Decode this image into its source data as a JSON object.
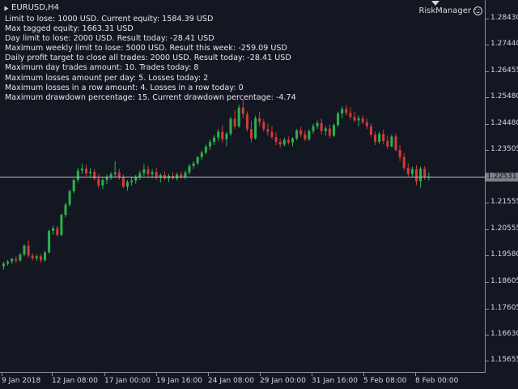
{
  "chart": {
    "symbol": "EURUSD,H4",
    "indicator_name": "RiskManager",
    "current_price": "1.22531",
    "colors": {
      "background": "#131722",
      "bull": "#2bb24c",
      "bear": "#d23b3b",
      "text": "#e6e6e6",
      "axis": "#8a8f99",
      "current_line": "#b9bcc3"
    }
  },
  "info_lines": [
    "Limit to lose: 1000 USD. Current equity: 1584.39 USD",
    "Max tagged equity: 1663.31 USD",
    "Day limit to lose: 2000 USD. Result today: -28.41 USD",
    "Maximum weekly limit to lose: 5000 USD. Result this week: -259.09 USD",
    "Daily profit target to close all trades: 2000 USD. Result today: -28.41 USD",
    "Maximum day trades amount: 10. Trades today: 8",
    "Maximum losses amount per day: 5. Losses today: 2",
    "Maximum losses in a row amount: 4. Losses in a row today: 0",
    "Maximum drawdown percentage: 15. Current drawdown percentage: -4.74"
  ],
  "price_axis": {
    "labels": [
      "1.28430",
      "1.27440",
      "1.26455",
      "1.25480",
      "1.24480",
      "1.23505",
      "1.22531",
      "1.21555",
      "1.20555",
      "1.19580",
      "1.18605",
      "1.17605",
      "1.16630",
      "1.15655"
    ],
    "min": 1.1545,
    "max": 1.2893
  },
  "time_axis": {
    "labels": [
      "9 Jan 2018",
      "12 Jan 08:00",
      "17 Jan 00:00",
      "19 Jan 16:00",
      "24 Jan 08:00",
      "29 Jan 00:00",
      "31 Jan 16:00",
      "5 Feb 08:00",
      "8 Feb 00:00"
    ]
  },
  "chart_data": {
    "type": "candlestick",
    "series": [
      {
        "o": 1.1918,
        "h": 1.1935,
        "l": 1.1905,
        "c": 1.1928
      },
      {
        "o": 1.1928,
        "h": 1.1942,
        "l": 1.192,
        "c": 1.1936
      },
      {
        "o": 1.1936,
        "h": 1.195,
        "l": 1.1926,
        "c": 1.1945
      },
      {
        "o": 1.1945,
        "h": 1.1955,
        "l": 1.193,
        "c": 1.194
      },
      {
        "o": 1.194,
        "h": 1.1968,
        "l": 1.1935,
        "c": 1.1962
      },
      {
        "o": 1.1962,
        "h": 1.2,
        "l": 1.1955,
        "c": 1.1995
      },
      {
        "o": 1.1995,
        "h": 1.2015,
        "l": 1.195,
        "c": 1.1958
      },
      {
        "o": 1.1958,
        "h": 1.1966,
        "l": 1.194,
        "c": 1.1948
      },
      {
        "o": 1.1948,
        "h": 1.1962,
        "l": 1.1938,
        "c": 1.1955
      },
      {
        "o": 1.1955,
        "h": 1.1965,
        "l": 1.193,
        "c": 1.194
      },
      {
        "o": 1.194,
        "h": 1.1975,
        "l": 1.1936,
        "c": 1.197
      },
      {
        "o": 1.197,
        "h": 1.2055,
        "l": 1.1965,
        "c": 1.205
      },
      {
        "o": 1.205,
        "h": 1.207,
        "l": 1.2035,
        "c": 1.206
      },
      {
        "o": 1.206,
        "h": 1.207,
        "l": 1.2028,
        "c": 1.2035
      },
      {
        "o": 1.2035,
        "h": 1.2115,
        "l": 1.203,
        "c": 1.211
      },
      {
        "o": 1.211,
        "h": 1.2155,
        "l": 1.21,
        "c": 1.2148
      },
      {
        "o": 1.2148,
        "h": 1.2205,
        "l": 1.214,
        "c": 1.2198
      },
      {
        "o": 1.2198,
        "h": 1.2245,
        "l": 1.219,
        "c": 1.224
      },
      {
        "o": 1.224,
        "h": 1.2285,
        "l": 1.223,
        "c": 1.2275
      },
      {
        "o": 1.2275,
        "h": 1.23,
        "l": 1.2262,
        "c": 1.2282
      },
      {
        "o": 1.2282,
        "h": 1.2296,
        "l": 1.2255,
        "c": 1.2265
      },
      {
        "o": 1.2265,
        "h": 1.2285,
        "l": 1.2248,
        "c": 1.227
      },
      {
        "o": 1.227,
        "h": 1.228,
        "l": 1.2238,
        "c": 1.2245
      },
      {
        "o": 1.2245,
        "h": 1.2262,
        "l": 1.221,
        "c": 1.222
      },
      {
        "o": 1.222,
        "h": 1.2248,
        "l": 1.2205,
        "c": 1.224
      },
      {
        "o": 1.224,
        "h": 1.226,
        "l": 1.2225,
        "c": 1.225
      },
      {
        "o": 1.225,
        "h": 1.227,
        "l": 1.224,
        "c": 1.2262
      },
      {
        "o": 1.2262,
        "h": 1.231,
        "l": 1.225,
        "c": 1.2268
      },
      {
        "o": 1.2268,
        "h": 1.2282,
        "l": 1.224,
        "c": 1.225
      },
      {
        "o": 1.225,
        "h": 1.226,
        "l": 1.221,
        "c": 1.2215
      },
      {
        "o": 1.2215,
        "h": 1.224,
        "l": 1.22,
        "c": 1.2232
      },
      {
        "o": 1.2232,
        "h": 1.225,
        "l": 1.2218,
        "c": 1.2238
      },
      {
        "o": 1.2238,
        "h": 1.2258,
        "l": 1.2226,
        "c": 1.2252
      },
      {
        "o": 1.2252,
        "h": 1.2275,
        "l": 1.224,
        "c": 1.2265
      },
      {
        "o": 1.2265,
        "h": 1.2298,
        "l": 1.2255,
        "c": 1.228
      },
      {
        "o": 1.228,
        "h": 1.2292,
        "l": 1.2252,
        "c": 1.2262
      },
      {
        "o": 1.2262,
        "h": 1.228,
        "l": 1.2245,
        "c": 1.227
      },
      {
        "o": 1.227,
        "h": 1.2285,
        "l": 1.224,
        "c": 1.2248
      },
      {
        "o": 1.2248,
        "h": 1.2265,
        "l": 1.223,
        "c": 1.2258
      },
      {
        "o": 1.2258,
        "h": 1.2272,
        "l": 1.224,
        "c": 1.2245
      },
      {
        "o": 1.2245,
        "h": 1.2262,
        "l": 1.2232,
        "c": 1.2255
      },
      {
        "o": 1.2255,
        "h": 1.227,
        "l": 1.224,
        "c": 1.2246
      },
      {
        "o": 1.2246,
        "h": 1.2268,
        "l": 1.2238,
        "c": 1.226
      },
      {
        "o": 1.226,
        "h": 1.2272,
        "l": 1.2244,
        "c": 1.225
      },
      {
        "o": 1.225,
        "h": 1.2275,
        "l": 1.2242,
        "c": 1.2268
      },
      {
        "o": 1.2268,
        "h": 1.23,
        "l": 1.226,
        "c": 1.2292
      },
      {
        "o": 1.2292,
        "h": 1.231,
        "l": 1.228,
        "c": 1.2302
      },
      {
        "o": 1.2302,
        "h": 1.233,
        "l": 1.2295,
        "c": 1.2325
      },
      {
        "o": 1.2325,
        "h": 1.235,
        "l": 1.2315,
        "c": 1.2342
      },
      {
        "o": 1.2342,
        "h": 1.2372,
        "l": 1.2335,
        "c": 1.2365
      },
      {
        "o": 1.2365,
        "h": 1.239,
        "l": 1.2352,
        "c": 1.2382
      },
      {
        "o": 1.2382,
        "h": 1.2408,
        "l": 1.237,
        "c": 1.2398
      },
      {
        "o": 1.2398,
        "h": 1.243,
        "l": 1.2385,
        "c": 1.242
      },
      {
        "o": 1.242,
        "h": 1.2445,
        "l": 1.238,
        "c": 1.2392
      },
      {
        "o": 1.2392,
        "h": 1.242,
        "l": 1.2365,
        "c": 1.2412
      },
      {
        "o": 1.2412,
        "h": 1.2475,
        "l": 1.2405,
        "c": 1.2468
      },
      {
        "o": 1.2468,
        "h": 1.25,
        "l": 1.243,
        "c": 1.244
      },
      {
        "o": 1.244,
        "h": 1.252,
        "l": 1.2435,
        "c": 1.251
      },
      {
        "o": 1.251,
        "h": 1.254,
        "l": 1.247,
        "c": 1.2485
      },
      {
        "o": 1.2485,
        "h": 1.2495,
        "l": 1.242,
        "c": 1.243
      },
      {
        "o": 1.243,
        "h": 1.246,
        "l": 1.238,
        "c": 1.2395
      },
      {
        "o": 1.2395,
        "h": 1.248,
        "l": 1.239,
        "c": 1.247
      },
      {
        "o": 1.247,
        "h": 1.2495,
        "l": 1.244,
        "c": 1.2455
      },
      {
        "o": 1.2455,
        "h": 1.2468,
        "l": 1.242,
        "c": 1.243
      },
      {
        "o": 1.243,
        "h": 1.245,
        "l": 1.2405,
        "c": 1.242
      },
      {
        "o": 1.242,
        "h": 1.244,
        "l": 1.2392,
        "c": 1.24
      },
      {
        "o": 1.24,
        "h": 1.2418,
        "l": 1.237,
        "c": 1.2382
      },
      {
        "o": 1.2382,
        "h": 1.2395,
        "l": 1.236,
        "c": 1.2372
      },
      {
        "o": 1.2372,
        "h": 1.2398,
        "l": 1.2365,
        "c": 1.239
      },
      {
        "o": 1.239,
        "h": 1.2402,
        "l": 1.2372,
        "c": 1.238
      },
      {
        "o": 1.238,
        "h": 1.24,
        "l": 1.2365,
        "c": 1.2395
      },
      {
        "o": 1.2395,
        "h": 1.243,
        "l": 1.2388,
        "c": 1.2425
      },
      {
        "o": 1.2425,
        "h": 1.244,
        "l": 1.24,
        "c": 1.241
      },
      {
        "o": 1.241,
        "h": 1.2425,
        "l": 1.2385,
        "c": 1.2392
      },
      {
        "o": 1.2392,
        "h": 1.243,
        "l": 1.2385,
        "c": 1.2422
      },
      {
        "o": 1.2422,
        "h": 1.245,
        "l": 1.2412,
        "c": 1.244
      },
      {
        "o": 1.244,
        "h": 1.2462,
        "l": 1.243,
        "c": 1.2452
      },
      {
        "o": 1.2452,
        "h": 1.247,
        "l": 1.241,
        "c": 1.2422
      },
      {
        "o": 1.2422,
        "h": 1.244,
        "l": 1.2405,
        "c": 1.2432
      },
      {
        "o": 1.2432,
        "h": 1.2448,
        "l": 1.2395,
        "c": 1.2405
      },
      {
        "o": 1.2405,
        "h": 1.245,
        "l": 1.24,
        "c": 1.2445
      },
      {
        "o": 1.2445,
        "h": 1.2495,
        "l": 1.2438,
        "c": 1.2488
      },
      {
        "o": 1.2488,
        "h": 1.2515,
        "l": 1.247,
        "c": 1.2505
      },
      {
        "o": 1.2505,
        "h": 1.252,
        "l": 1.248,
        "c": 1.249
      },
      {
        "o": 1.249,
        "h": 1.2512,
        "l": 1.2465,
        "c": 1.2475
      },
      {
        "o": 1.2475,
        "h": 1.2495,
        "l": 1.2455,
        "c": 1.2462
      },
      {
        "o": 1.2462,
        "h": 1.248,
        "l": 1.244,
        "c": 1.247
      },
      {
        "o": 1.247,
        "h": 1.2482,
        "l": 1.2448,
        "c": 1.2455
      },
      {
        "o": 1.2455,
        "h": 1.247,
        "l": 1.243,
        "c": 1.244
      },
      {
        "o": 1.244,
        "h": 1.2452,
        "l": 1.24,
        "c": 1.2408
      },
      {
        "o": 1.2408,
        "h": 1.242,
        "l": 1.237,
        "c": 1.2382
      },
      {
        "o": 1.2382,
        "h": 1.242,
        "l": 1.2375,
        "c": 1.2412
      },
      {
        "o": 1.2412,
        "h": 1.2428,
        "l": 1.2372,
        "c": 1.2385
      },
      {
        "o": 1.2385,
        "h": 1.2405,
        "l": 1.2355,
        "c": 1.2365
      },
      {
        "o": 1.2365,
        "h": 1.241,
        "l": 1.236,
        "c": 1.2402
      },
      {
        "o": 1.2402,
        "h": 1.2415,
        "l": 1.2345,
        "c": 1.2352
      },
      {
        "o": 1.2352,
        "h": 1.237,
        "l": 1.231,
        "c": 1.2325
      },
      {
        "o": 1.2325,
        "h": 1.234,
        "l": 1.2275,
        "c": 1.2285
      },
      {
        "o": 1.2285,
        "h": 1.2302,
        "l": 1.2252,
        "c": 1.2262
      },
      {
        "o": 1.2262,
        "h": 1.229,
        "l": 1.225,
        "c": 1.228
      },
      {
        "o": 1.228,
        "h": 1.2295,
        "l": 1.222,
        "c": 1.2235
      },
      {
        "o": 1.2235,
        "h": 1.229,
        "l": 1.221,
        "c": 1.2282
      },
      {
        "o": 1.2282,
        "h": 1.2292,
        "l": 1.224,
        "c": 1.225
      },
      {
        "o": 1.225,
        "h": 1.2268,
        "l": 1.2238,
        "c": 1.2253
      }
    ]
  }
}
